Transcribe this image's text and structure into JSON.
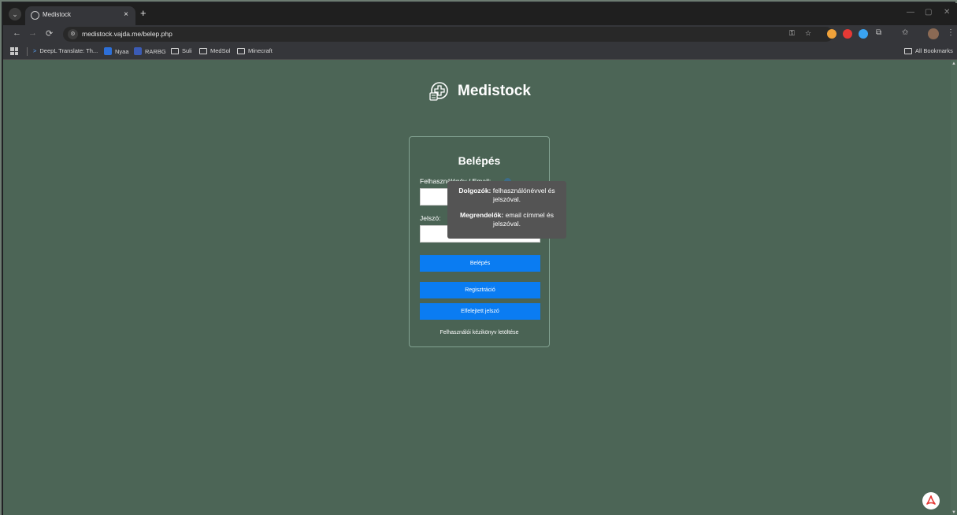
{
  "browser": {
    "tab": {
      "title": "Medistock",
      "close": "×"
    },
    "new_tab": "+",
    "tab_menu": "⌄",
    "window": {
      "minimize": "—",
      "restore": "▢",
      "close": "✕"
    },
    "nav": {
      "back": "←",
      "forward": "→",
      "reload": "⟳"
    },
    "url": "medistock.vajda.me/belep.php",
    "bookmarks": [
      {
        "label": "DeepL Translate: Th...",
        "icon": "deepl-icon"
      },
      {
        "label": "Nyaa",
        "icon": "nyaa-icon"
      },
      {
        "label": "RARBG",
        "icon": "rarbg-icon"
      },
      {
        "label": "Suli",
        "icon": "folder-icon"
      },
      {
        "label": "MedSol",
        "icon": "folder-icon"
      },
      {
        "label": "Minecraft",
        "icon": "folder-icon"
      }
    ],
    "all_bookmarks": "All Bookmarks"
  },
  "page": {
    "brand": "Medistock",
    "login": {
      "title": "Belépés",
      "user_label": "Felhasználónév / Email:",
      "password_label": "Jelszó:",
      "submit": "Belépés",
      "register": "Regisztráció",
      "forgot": "Elfelejtett jelszó",
      "manual": "Felhasználói kézikönyv letöltése"
    },
    "tooltip": {
      "workers_bold": "Dolgozók:",
      "workers_text": " felhasználónévvel és jelszóval.",
      "customers_bold": "Megrendelők:",
      "customers_text": " email címmel és jelszóval."
    }
  },
  "colors": {
    "page_bg": "#4c6556",
    "button": "#0a7cf2",
    "tooltip_bg": "#545454",
    "card_border": "#82a291"
  }
}
